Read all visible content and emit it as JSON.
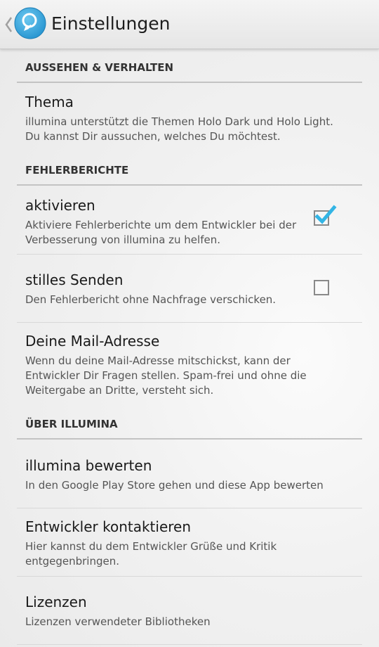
{
  "actionbar": {
    "title": "Einstellungen",
    "up_icon": "chevron-left-icon",
    "app_icon": "lightbulb-icon"
  },
  "colors": {
    "accent": "#33b5e5",
    "app_icon_blue": "#35a7dc"
  },
  "sections": [
    {
      "header": "AUSSEHEN & VERHALTEN",
      "items": [
        {
          "title": "Thema",
          "summary": "illumina unterstützt die Themen Holo Dark und Holo Light. Du kannst Dir aussuchen, welches Du möchtest."
        }
      ]
    },
    {
      "header": "FEHLERBERICHTE",
      "items": [
        {
          "title": "aktivieren",
          "summary": "Aktiviere Fehlerberichte um dem Entwickler bei der Verbesserung von illumina zu helfen.",
          "checked": true
        },
        {
          "title": "stilles Senden",
          "summary": "Den Fehlerbericht ohne Nachfrage verschicken.",
          "checked": false
        },
        {
          "title": "Deine Mail-Adresse",
          "summary": "Wenn du deine Mail-Adresse mitschickst, kann der Entwickler Dir Fragen stellen. Spam-frei und ohne die Weitergabe an Dritte, versteht sich."
        }
      ]
    },
    {
      "header": "ÜBER ILLUMINA",
      "items": [
        {
          "title": "illumina bewerten",
          "summary": "In den Google Play Store gehen und diese App bewerten"
        },
        {
          "title": "Entwickler kontaktieren",
          "summary": "Hier kannst du dem Entwickler Grüße und Kritik entgegenbringen."
        },
        {
          "title": "Lizenzen",
          "summary": "Lizenzen verwendeter Bibliotheken"
        }
      ]
    }
  ]
}
